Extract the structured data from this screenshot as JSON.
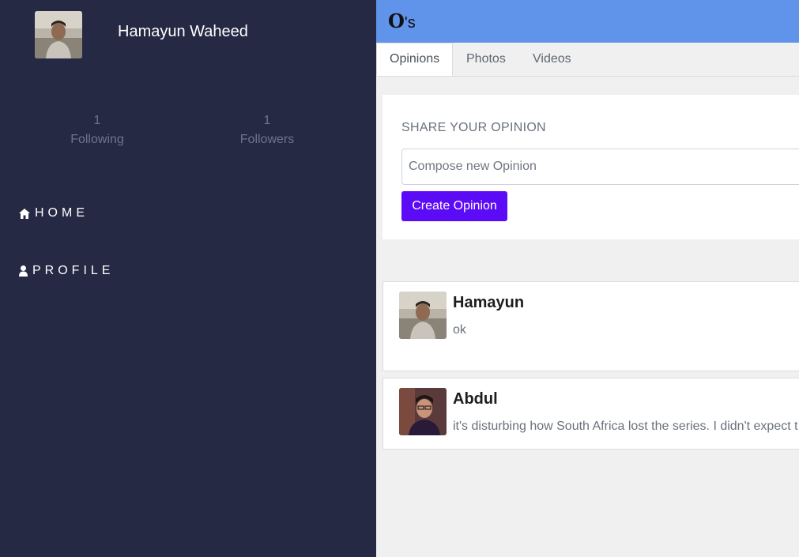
{
  "profile": {
    "name": "Hamayun Waheed",
    "following_count": "1",
    "following_label": "Following",
    "followers_count": "1",
    "followers_label": "Followers"
  },
  "nav": {
    "home_label": "HOME",
    "profile_label": "PROFILE"
  },
  "brand": {
    "logo_main": "O",
    "logo_suffix": "'s",
    "color": "#6093ea"
  },
  "tabs": [
    {
      "label": "Opinions"
    },
    {
      "label": "Photos"
    },
    {
      "label": "Videos"
    }
  ],
  "compose": {
    "title": "SHARE YOUR OPINION",
    "placeholder": "Compose new Opinion",
    "button_label": "Create Opinion",
    "button_color": "#5b0bf5"
  },
  "posts": [
    {
      "author": "Hamayun",
      "text": "ok"
    },
    {
      "author": "Abdul",
      "text": "it's disturbing how South Africa lost the series. I didn't expect t"
    }
  ],
  "colors": {
    "sidebar": "#252944",
    "background": "#f0f0f0"
  }
}
